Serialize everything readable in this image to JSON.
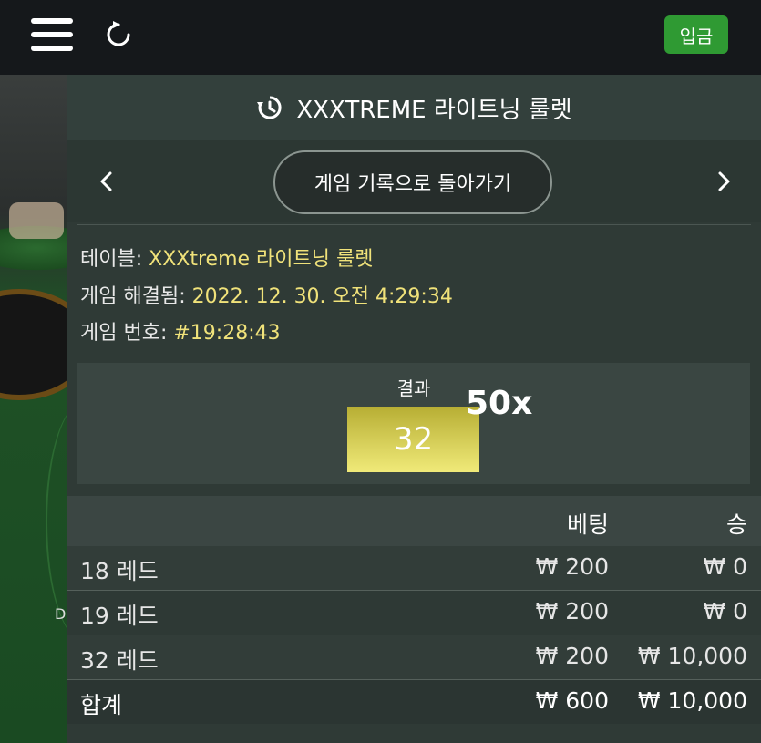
{
  "topbar": {
    "menu_icon": "hamburger-menu-icon",
    "refresh_icon": "refresh-icon",
    "deposit_label": "입금",
    "deposit_color": "#2f9a33"
  },
  "background": {
    "letter": "D"
  },
  "panel": {
    "title": "XXXTREME 라이트닝 룰렛",
    "title_icon": "history-icon",
    "back_label": "게임 기록으로 돌아가기",
    "prev_icon": "chevron-left-icon",
    "next_icon": "chevron-right-icon",
    "info": {
      "table_label": "테이블:",
      "table_value": "XXXtreme 라이트닝 룰렛",
      "resolved_label": "게임 해결됨:",
      "resolved_value": "2022. 12. 30. 오전 4:29:34",
      "round_label": "게임 번호:",
      "round_value": "#19:28:43"
    },
    "result": {
      "label": "결과",
      "number": "32",
      "multiplier": "50x"
    },
    "table": {
      "headers": {
        "bet": "베팅",
        "win": "승"
      },
      "rows": [
        {
          "name": "18 레드",
          "bet": "₩ 200",
          "win": "₩ 0"
        },
        {
          "name": "19 레드",
          "bet": "₩ 200",
          "win": "₩ 0"
        },
        {
          "name": "32 레드",
          "bet": "₩ 200",
          "win": "₩ 10,000"
        }
      ],
      "total": {
        "name": "합계",
        "bet": "₩ 600",
        "win": "₩ 10,000"
      }
    }
  }
}
